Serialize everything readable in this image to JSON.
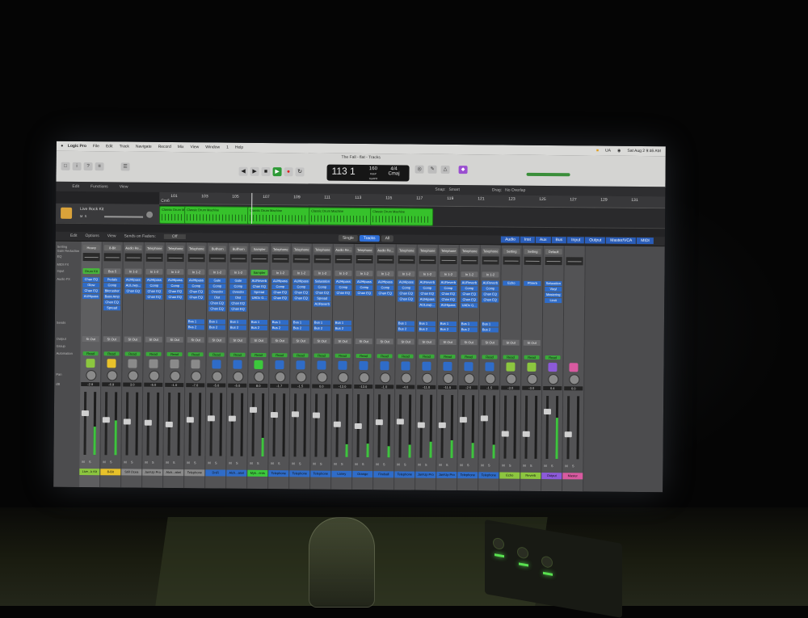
{
  "menubar": {
    "items": [
      "Logic Pro",
      "File",
      "Edit",
      "Track",
      "Navigate",
      "Record",
      "Mix",
      "View",
      "Window",
      "1",
      "Help"
    ],
    "input_lang": "UA",
    "clock": "Sat Aug 2  9:46 AM"
  },
  "window": {
    "title": "The Fall - flat - Tracks"
  },
  "lcd": {
    "position": "113  1",
    "tempo": "160",
    "tempo_label": "KEEP",
    "tempo_sub": "TEMPO",
    "signature": "4/4",
    "key": "Cmaj"
  },
  "tracks_header": {
    "edit": "Edit",
    "functions": "Functions",
    "view": "View",
    "snap_label": "Snap:",
    "snap_value": "Smart",
    "drag_label": "Drag:",
    "drag_value": "No Overlap"
  },
  "ruler": {
    "bars": [
      "101",
      "103",
      "105",
      "107",
      "109",
      "111",
      "113",
      "115",
      "117",
      "119",
      "121",
      "123",
      "125",
      "127",
      "129",
      "131"
    ],
    "marker": "Cm6"
  },
  "track": {
    "name": "Live Rock Kit"
  },
  "regions": [
    {
      "name": "Classic Drum Machine"
    },
    {
      "name": "Classic Drum Machine"
    },
    {
      "name": "Classic Drum Machine"
    },
    {
      "name": "Classic Drum Machine"
    },
    {
      "name": "Classic Drum Machine"
    }
  ],
  "mixer_bar": {
    "edit": "Edit",
    "options": "Options",
    "view": "View",
    "sends_on_faders": "Sends on Faders:",
    "sends_value": "Off",
    "view_modes": [
      "Single",
      "Tracks",
      "All"
    ],
    "filters": [
      "Audio",
      "Inst",
      "Aux",
      "Bus",
      "Input",
      "Output",
      "Master/VCA",
      "MIDI"
    ]
  },
  "row_labels": {
    "setting": "Setting",
    "gain_reduction": "Gain Reduction",
    "eq": "EQ",
    "midi_fx": "MIDI FX",
    "input": "Input",
    "audio_fx": "Audio FX",
    "sends": "Sends",
    "output": "Output",
    "group": "Group",
    "automation": "Automation",
    "pan": "Pan",
    "db": "dB"
  },
  "strips": [
    {
      "setting": "Heavy",
      "input": "Drum Kit",
      "plugins": [
        "Chan EQ",
        "Glow",
        "Chan EQ",
        "AUHipass"
      ],
      "sends": [],
      "output": "St Out",
      "auto": "Read",
      "db": "-2.9",
      "name": "Live...k Kit",
      "color": "#8cc63f"
    },
    {
      "setting": "8-Bit",
      "input": "Bus 5",
      "plugins": [
        "Pedals",
        "Comp",
        "Bitcrusher",
        "Bass Amp",
        "Chan EQ",
        "Spread"
      ],
      "sends": [],
      "output": "St Out",
      "auto": "Read",
      "db": "-6.9",
      "name": "8-Bit",
      "color": "#e8c22a"
    },
    {
      "setting": "Audio Re...",
      "input": "In 1-2",
      "plugins": [
        "AUHipass",
        "AULowp...",
        "Chan EQ"
      ],
      "sends": [],
      "output": "St Out",
      "auto": "Read",
      "db": "3.0",
      "name": "Still Ocea",
      "color": "#8a8a8a"
    },
    {
      "setting": "Telephone",
      "input": "In 1-2",
      "plugins": [
        "AUHipass",
        "Comp",
        "Chan EQ",
        "Chan EQ"
      ],
      "sends": [],
      "output": "St Out",
      "auto": "Read",
      "db": "-5.0",
      "name": "JamUp Pro",
      "color": "#8a8a8a"
    },
    {
      "setting": "Telephone",
      "input": "In 1-2",
      "plugins": [
        "AUHipass",
        "Comp",
        "Chan EQ",
        "Chan EQ"
      ],
      "sends": [],
      "output": "St Out",
      "auto": "Read",
      "db": "-1.0",
      "name": "Alch...atori",
      "color": "#8a8a8a"
    },
    {
      "setting": "Telephone",
      "input": "In 1-2",
      "plugins": [
        "AUHipass",
        "Comp",
        "Chan EQ",
        "Chan EQ"
      ],
      "sends": [
        "Bus 1",
        "Bus 2"
      ],
      "output": "St Out",
      "auto": "Read",
      "db": "-7.0",
      "name": "Telephone",
      "color": "#8a8a8a"
    },
    {
      "setting": "Bullhorn",
      "input": "In 1-2",
      "plugins": [
        "Gate",
        "Comp",
        "Overdrv",
        "Dist",
        "Chan EQ",
        "Chan EQ"
      ],
      "sends": [
        "Bus 1",
        "Bus 2"
      ],
      "output": "St Out",
      "auto": "Read",
      "db": "-5.0",
      "name": "DnFi",
      "color": "#2f6cc8"
    },
    {
      "setting": "Bullhorn",
      "input": "In 1-2",
      "plugins": [
        "Gate",
        "Comp",
        "Overdrv",
        "Dist",
        "Chan EQ",
        "Chan EQ"
      ],
      "sends": [
        "Bus 1",
        "Bus 2"
      ],
      "output": "St Out",
      "auto": "Read",
      "db": "-5.0",
      "name": "Alch...atori",
      "color": "#2f6cc8"
    },
    {
      "setting": "Sampler",
      "input": "Sampler",
      "plugins": [
        "AUReverb",
        "Chan EQ",
        "Spread",
        "UADx G..."
      ],
      "sends": [
        "Bus 1",
        "Bus 2"
      ],
      "output": "St Out",
      "auto": "Read",
      "db": "8.0",
      "name": "Myk...ents",
      "color": "#3cc83c"
    },
    {
      "setting": "Telephone",
      "input": "In 1-2",
      "plugins": [
        "AUHipass",
        "Comp",
        "Chan EQ",
        "Chan EQ"
      ],
      "sends": [
        "Bus 1",
        "Bus 2"
      ],
      "output": "St Out",
      "auto": "Read",
      "db": "-1.7",
      "name": "Telephone",
      "color": "#2f6cc8"
    },
    {
      "setting": "Telephone",
      "input": "In 1-2",
      "plugins": [
        "AUHipass",
        "Comp",
        "Chan EQ",
        "Chan EQ"
      ],
      "sends": [
        "Bus 1",
        "Bus 2"
      ],
      "output": "St Out",
      "auto": "Read",
      "db": "-1.5",
      "name": "Telephone",
      "color": "#2f6cc8"
    },
    {
      "setting": "Telephone",
      "input": "In 1-2",
      "plugins": [
        "Saturation",
        "Comp",
        "Chan EQ",
        "Spread",
        "AUReverb"
      ],
      "sends": [
        "Bus 1",
        "Bus 2"
      ],
      "output": "St Out",
      "auto": "Read",
      "db": "0.0",
      "name": "Telephone",
      "color": "#2f6cc8"
    },
    {
      "setting": "Audio Re...",
      "input": "In 1-2",
      "plugins": [
        "AUHipass",
        "Comp",
        "Chan EQ"
      ],
      "sends": [
        "Bus 1",
        "Bus 2"
      ],
      "output": "St Out",
      "auto": "Read",
      "db": "-13.0",
      "name": "Laney",
      "color": "#2f6cc8"
    },
    {
      "setting": "Telephone",
      "input": "In 1-2",
      "plugins": [
        "AUHipass",
        "Comp",
        "Chan EQ"
      ],
      "sends": [],
      "output": "St Out",
      "auto": "Read",
      "db": "-13.0",
      "name": "Orange",
      "color": "#2f6cc8"
    },
    {
      "setting": "Audio Re...",
      "input": "In 1-2",
      "plugins": [
        "AUHipass",
        "Comp",
        "Chan EQ"
      ],
      "sends": [],
      "output": "St Out",
      "auto": "Read",
      "db": "-1.0",
      "name": "Fireball",
      "color": "#2f6cc8"
    },
    {
      "setting": "Telephone",
      "input": "In 1-2",
      "plugins": [
        "AUHipass",
        "Comp",
        "Chan EQ",
        "Chan EQ"
      ],
      "sends": [
        "Bus 1",
        "Bus 2"
      ],
      "output": "St Out",
      "auto": "Read",
      "db": "-4.0",
      "name": "Telephone",
      "color": "#2f6cc8"
    },
    {
      "setting": "Telephone",
      "input": "In 1-2",
      "plugins": [
        "AUReverb",
        "Comp",
        "Chan EQ",
        "AUHipass",
        "AULowp..."
      ],
      "sends": [
        "Bus 1",
        "Bus 2"
      ],
      "output": "St Out",
      "auto": "Read",
      "db": "-11.0",
      "name": "JamUp Pro",
      "color": "#2f6cc8"
    },
    {
      "setting": "Telephone",
      "input": "In 1-2",
      "plugins": [
        "AUReverb",
        "Comp",
        "Chan EQ",
        "Chan EQ",
        "AUHipass"
      ],
      "sends": [
        "Bus 1",
        "Bus 2"
      ],
      "output": "St Out",
      "auto": "Read",
      "db": "-11.0",
      "name": "JamUp Pro",
      "color": "#2f6cc8"
    },
    {
      "setting": "Telephone",
      "input": "In 1-2",
      "plugins": [
        "AUReverb",
        "Comp",
        "Chan EQ",
        "Chan EQ",
        "UADx G..."
      ],
      "sends": [
        "Bus 1",
        "Bus 2"
      ],
      "output": "St Out",
      "auto": "Read",
      "db": "-2.5",
      "name": "Telephone",
      "color": "#2f6cc8"
    },
    {
      "setting": "Telephone",
      "input": "In 1-2",
      "plugins": [
        "AUReverb",
        "Comp",
        "Chan EQ",
        "Chan EQ"
      ],
      "sends": [
        "Bus 1",
        "Bus 2"
      ],
      "output": "St Out",
      "auto": "Read",
      "db": "-1.5",
      "name": "Telephone",
      "color": "#2f6cc8"
    },
    {
      "setting": "Setting",
      "input": "",
      "plugins": [
        "Echo"
      ],
      "sends": [],
      "output": "St Out",
      "auto": "Read",
      "db": "-3.0",
      "name": "Echo",
      "color": "#8cc63f"
    },
    {
      "setting": "Setting",
      "input": "",
      "plugins": [
        "PtVerb"
      ],
      "sends": [],
      "output": "St Out",
      "auto": "Read",
      "db": "-3.0",
      "name": "Reverb",
      "color": "#8cc63f"
    },
    {
      "setting": "Default",
      "input": "",
      "plugins": [
        "Saturation",
        "Vinyl",
        "Mastering",
        "Limit"
      ],
      "sends": [],
      "output": "",
      "auto": "Read",
      "db": "0.4",
      "name": "Output",
      "color": "#8c5ad8"
    },
    {
      "setting": "",
      "input": "",
      "plugins": [],
      "sends": [],
      "output": "",
      "auto": "",
      "db": "0.0",
      "name": "Master",
      "color": "#d85aa0"
    }
  ]
}
